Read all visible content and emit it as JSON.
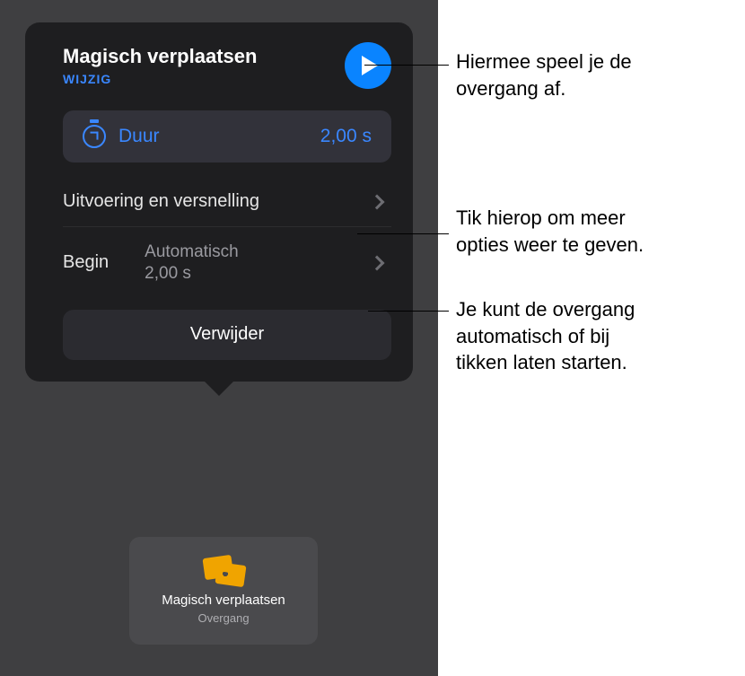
{
  "popover": {
    "title": "Magisch verplaatsen",
    "edit": "WIJZIG",
    "duration_label": "Duur",
    "duration_value": "2,00 s",
    "exec_accel": "Uitvoering en versnelling",
    "begin_label": "Begin",
    "begin_value_line1": "Automatisch",
    "begin_value_line2": "2,00 s",
    "delete": "Verwijder"
  },
  "thumb": {
    "title": "Magisch verplaatsen",
    "sub": "Overgang"
  },
  "callouts": {
    "c1": "Hiermee speel je de\novergang af.",
    "c2": "Tik hierop om meer\nopties weer te geven.",
    "c3": "Je kunt de overgang\nautomatisch of bij\ntikken laten starten."
  }
}
